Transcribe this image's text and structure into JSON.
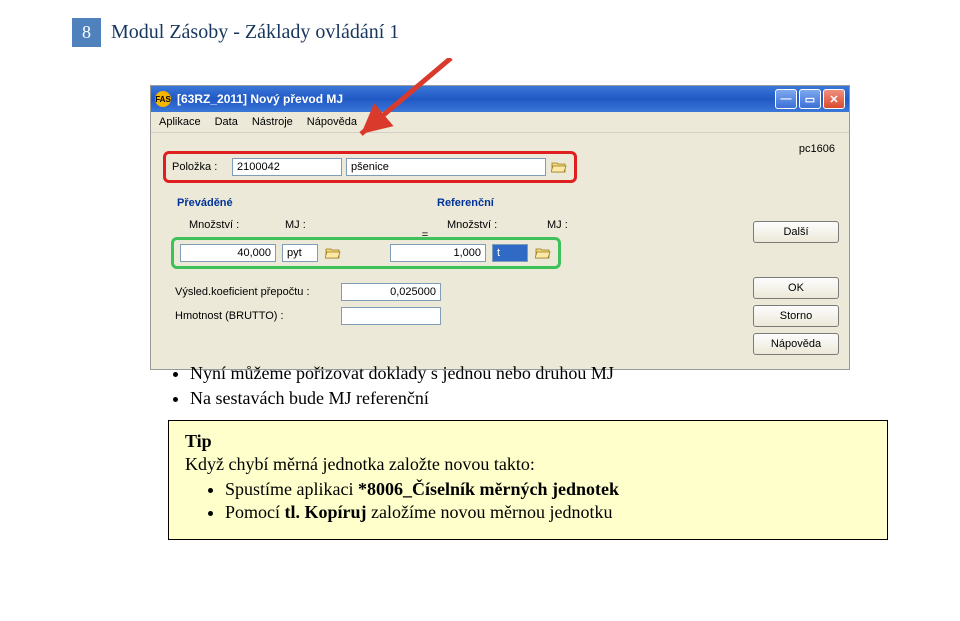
{
  "page": {
    "number": "8",
    "title": "Modul Zásoby - Základy ovládání 1"
  },
  "window": {
    "title": "[63RZ_2011] Nový převod MJ",
    "titlebar_icon_text": "FAS",
    "min_glyph": "—",
    "max_glyph": "▭",
    "close_glyph": "✕",
    "menu": {
      "aplikace": "Aplikace",
      "data": "Data",
      "nastroje": "Nástroje",
      "napoveda": "Nápověda"
    },
    "pc_id": "pc1606",
    "buttons": {
      "dalsi": "Další",
      "ok": "OK",
      "storno": "Storno",
      "napoveda": "Nápověda"
    },
    "polozka": {
      "label": "Položka :",
      "code": "2100042",
      "name": "pšenice"
    },
    "sections": {
      "prevadene": "Převáděné",
      "referencni": "Referenční"
    },
    "col_headers": {
      "mnozstvi": "Množství :",
      "mj": "MJ :",
      "eq": "="
    },
    "values": {
      "qty1": "40,000",
      "unit1": "pyt",
      "qty2": "1,000",
      "unit2": "t"
    },
    "coef": {
      "label": "Výsled.koeficient přepočtu :",
      "value": "0,025000"
    },
    "brutto": {
      "label": "Hmotnost (BRUTTO) :",
      "value": ""
    }
  },
  "bullets": {
    "line1": "Nyní můžeme pořizovat doklady s jednou nebo druhou MJ",
    "line2": "Na sestavách bude MJ referenční"
  },
  "tip": {
    "title": "Tip",
    "intro": "Když chybí měrná jednotka založte novou takto:",
    "li1_prefix": "Spustíme aplikaci ",
    "li1_bold": "*8006_Číselník měrných jednotek",
    "li2_prefix": "Pomocí ",
    "li2_bold": "tl. Kopíruj",
    "li2_suffix": " založíme novou měrnou jednotku"
  }
}
